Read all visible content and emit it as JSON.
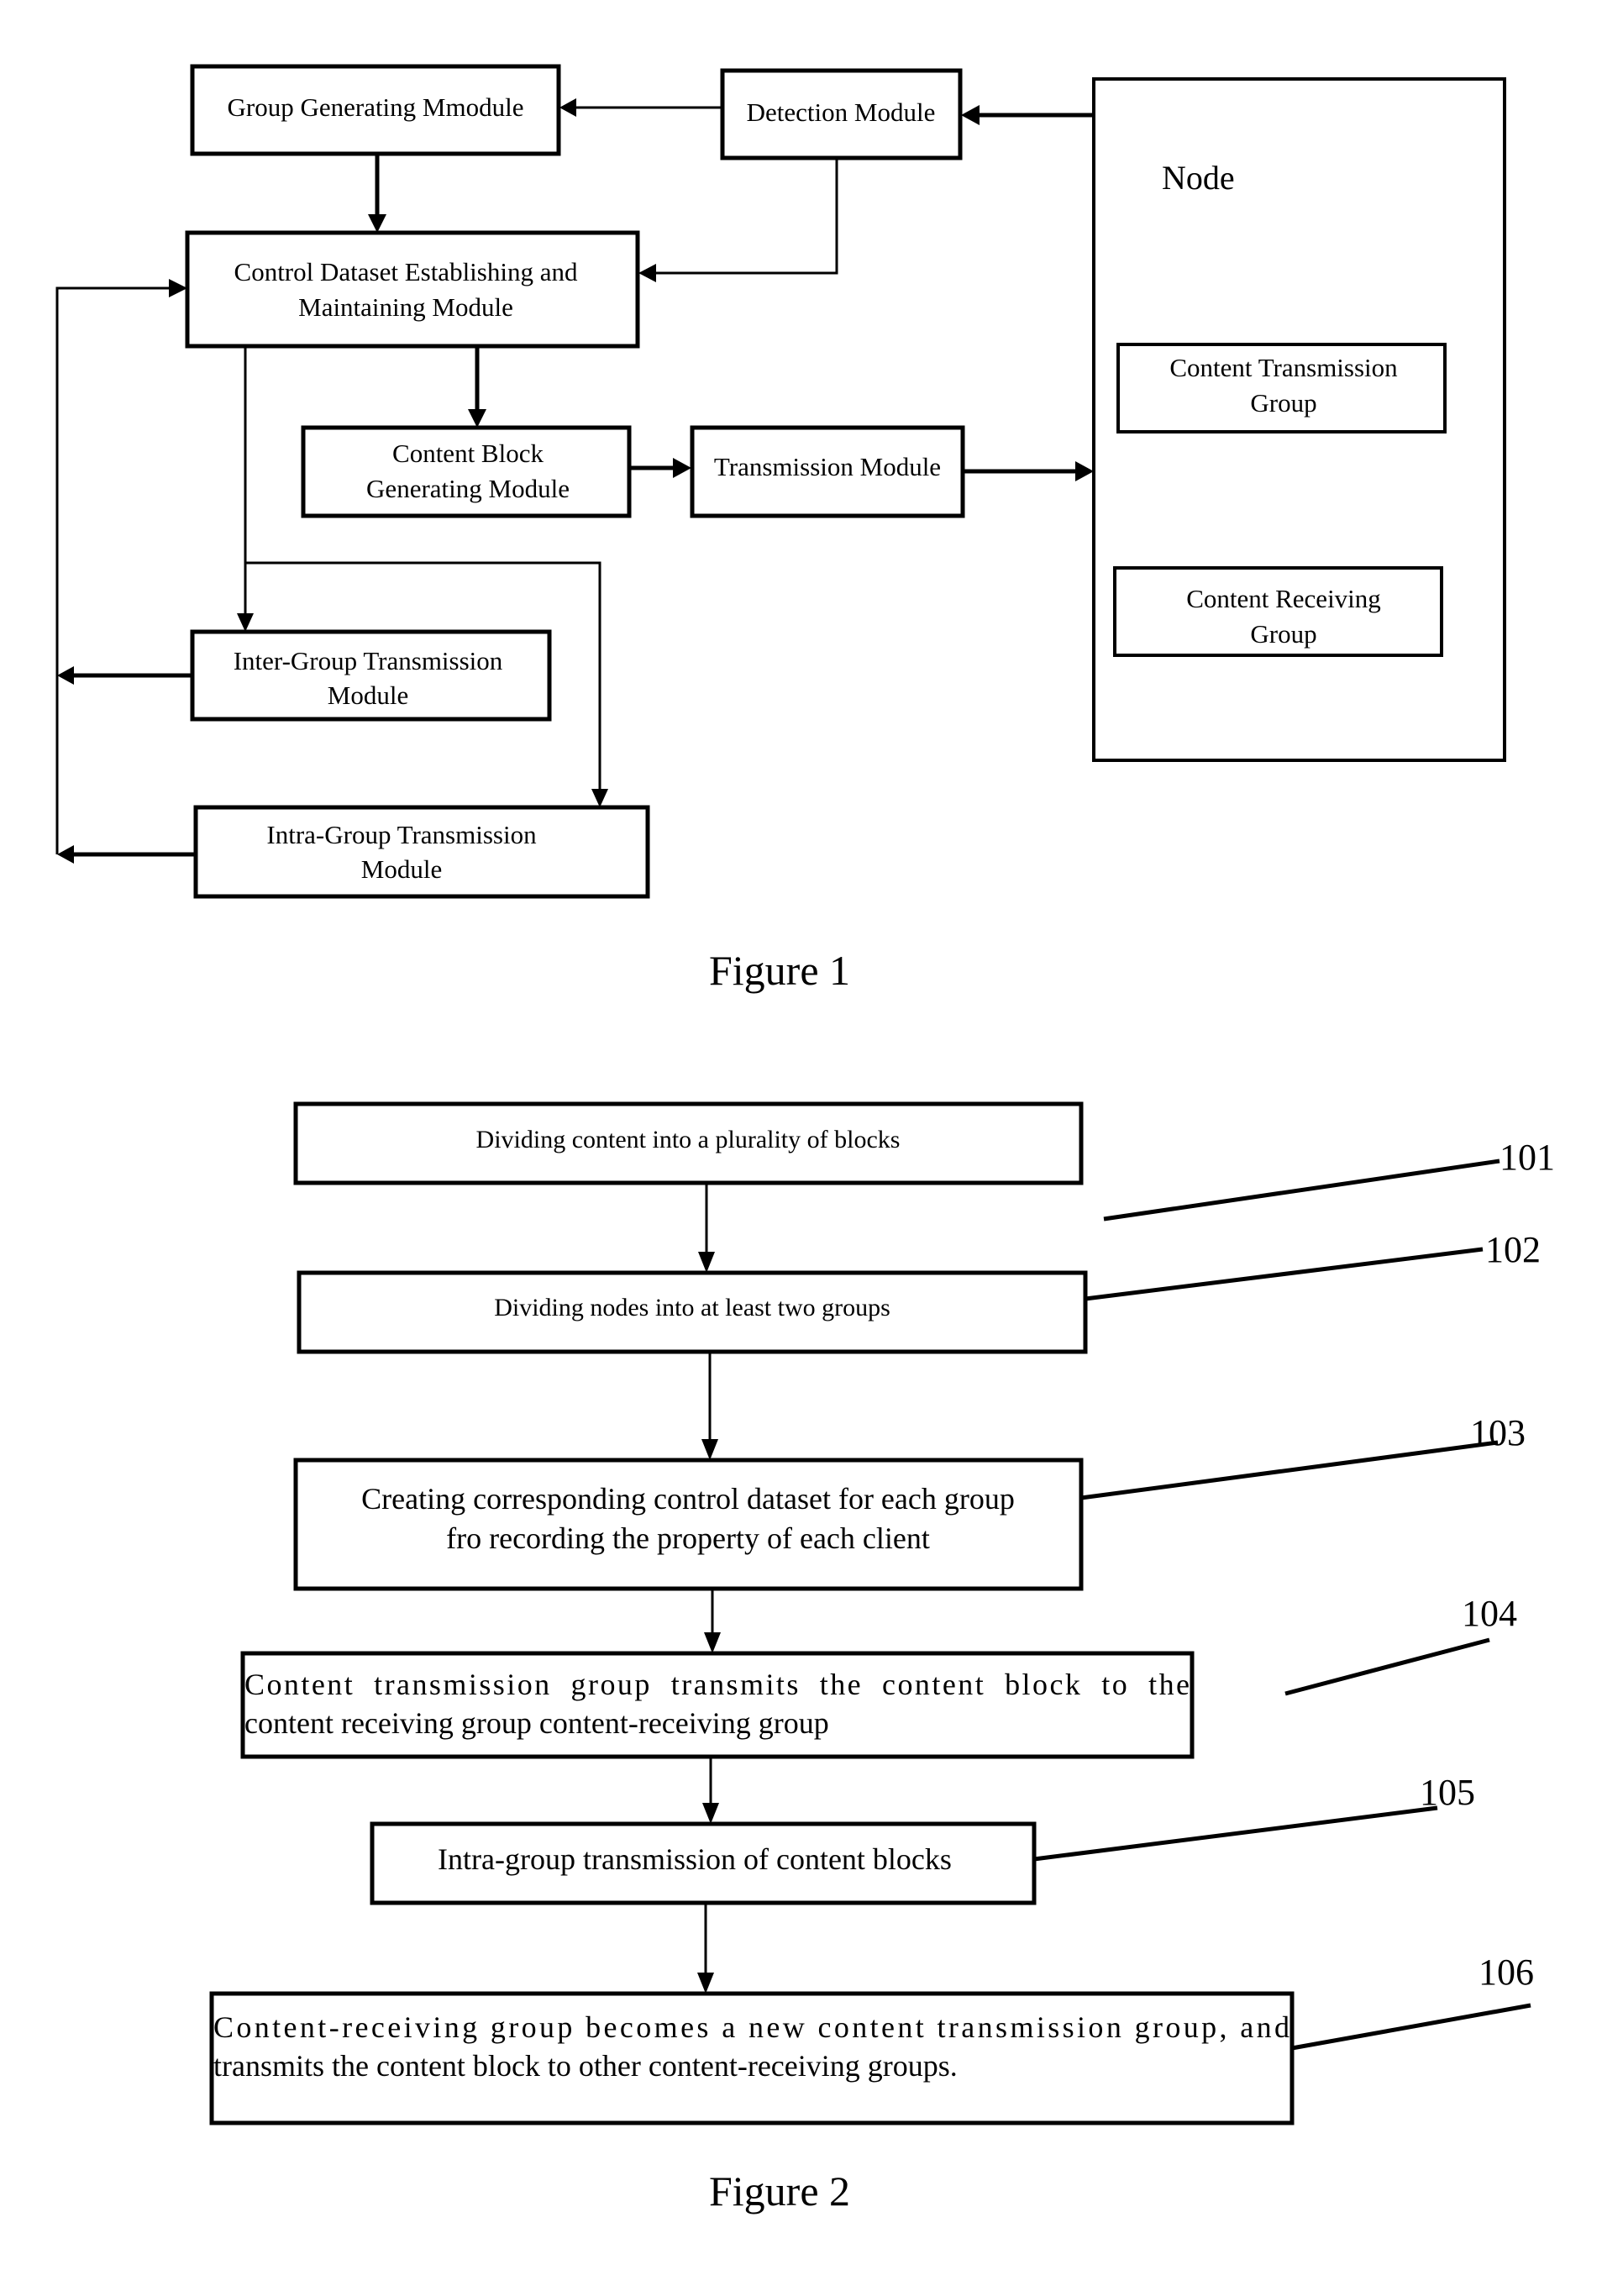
{
  "figure1": {
    "caption": "Figure 1",
    "modules": {
      "group_generating": [
        "Group Generating Mmodule"
      ],
      "detection": [
        "Detection Module"
      ],
      "control_dataset": [
        "Control Dataset Establishing and",
        "Maintaining Module"
      ],
      "content_block": [
        "Content Block",
        "Generating Module"
      ],
      "transmission": [
        "Transmission Module"
      ],
      "inter_group": [
        "Inter-Group Transmission",
        "Module"
      ],
      "intra_group": [
        "Intra-Group Transmission",
        "Module"
      ]
    },
    "node": {
      "title": "Node",
      "content_transmission_group": [
        "Content Transmission",
        "Group"
      ],
      "content_receiving_group": [
        "Content Receiving",
        "Group"
      ]
    }
  },
  "figure2": {
    "caption": "Figure 2",
    "steps": [
      {
        "ref": "101",
        "lines": [
          "Dividing content into a plurality of blocks"
        ]
      },
      {
        "ref": "102",
        "lines": [
          "Dividing nodes into at least two groups"
        ]
      },
      {
        "ref": "103",
        "lines": [
          "Creating corresponding control dataset for each group",
          "fro recording the property of each client"
        ]
      },
      {
        "ref": "104",
        "lines": [
          "Content  transmission  group  transmits  the  content  block  to  the",
          "content receiving group content-receiving group"
        ]
      },
      {
        "ref": "105",
        "lines": [
          "Intra-group transmission of content blocks"
        ]
      },
      {
        "ref": "106",
        "lines": [
          "Content-receiving group becomes a new content transmission group, and",
          "transmits the content block to other content-receiving groups."
        ]
      }
    ]
  }
}
